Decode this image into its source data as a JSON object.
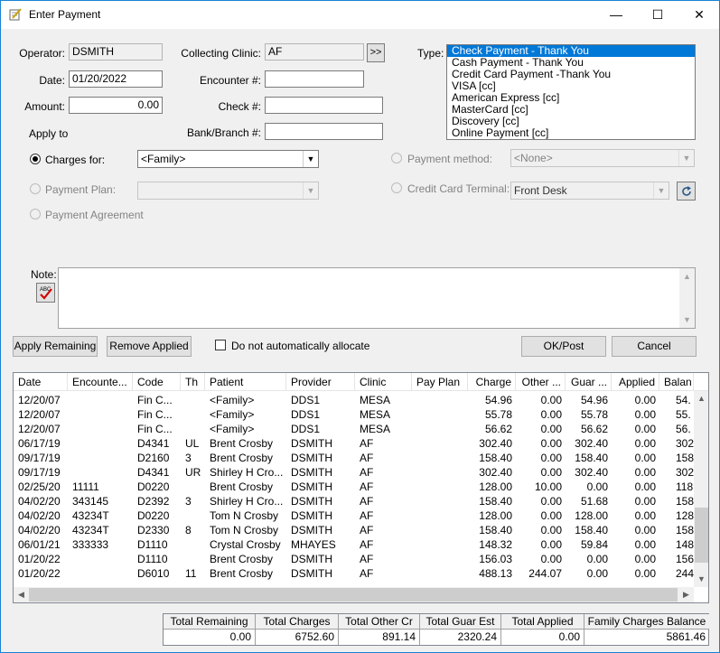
{
  "window": {
    "title": "Enter Payment",
    "minimize": "—",
    "maximize": "☐",
    "close": "✕"
  },
  "form": {
    "operator_label": "Operator:",
    "operator_value": "DSMITH",
    "date_label": "Date:",
    "date_value": "01/20/2022",
    "amount_label": "Amount:",
    "amount_value": "0.00",
    "apply_to_label": "Apply to",
    "collecting_clinic_label": "Collecting Clinic:",
    "collecting_clinic_value": "AF",
    "clinic_pick_button": ">>",
    "encounter_label": "Encounter #:",
    "encounter_value": "",
    "check_label": "Check #:",
    "check_value": "",
    "bank_label": "Bank/Branch #:",
    "bank_value": "",
    "type_label": "Type:",
    "type_options": [
      "Check Payment - Thank You",
      "Cash Payment - Thank You",
      "Credit Card Payment -Thank You",
      "VISA [cc]",
      "American Express [cc]",
      "MasterCard [cc]",
      "Discovery [cc]",
      "Online Payment [cc]"
    ],
    "charges_for_label": "Charges for:",
    "charges_for_value": "<Family>",
    "payment_plan_label": "Payment Plan:",
    "payment_plan_value": "",
    "payment_agreement_label": "Payment Agreement",
    "payment_method_label": "Payment method:",
    "payment_method_value": "<None>",
    "cc_terminal_label": "Credit Card Terminal:",
    "cc_terminal_value": "Front Desk",
    "note_label": "Note:",
    "spell_icon_text": "ABC"
  },
  "buttons": {
    "apply_remaining": "Apply Remaining",
    "remove_applied": "Remove Applied",
    "no_auto_allocate": "Do not automatically allocate",
    "ok_post": "OK/Post",
    "cancel": "Cancel"
  },
  "grid": {
    "headers": [
      "Date",
      "Encounte...",
      "Code",
      "Th",
      "Patient",
      "Provider",
      "Clinic",
      "Pay Plan",
      "Charge",
      "Other ...",
      "Guar ...",
      "Applied",
      "Balan"
    ],
    "rows": [
      [
        "12/20/07",
        "",
        "Fin C...",
        "",
        "<Family>",
        "DDS1",
        "MESA",
        "",
        "54.96",
        "0.00",
        "54.96",
        "0.00",
        "54."
      ],
      [
        "12/20/07",
        "",
        "Fin C...",
        "",
        "<Family>",
        "DDS1",
        "MESA",
        "",
        "55.78",
        "0.00",
        "55.78",
        "0.00",
        "55."
      ],
      [
        "12/20/07",
        "",
        "Fin C...",
        "",
        "<Family>",
        "DDS1",
        "MESA",
        "",
        "56.62",
        "0.00",
        "56.62",
        "0.00",
        "56."
      ],
      [
        "06/17/19",
        "",
        "D4341",
        "UL",
        "Brent Crosby",
        "DSMITH",
        "AF",
        "",
        "302.40",
        "0.00",
        "302.40",
        "0.00",
        "302."
      ],
      [
        "09/17/19",
        "",
        "D2160",
        "3",
        "Brent Crosby",
        "DSMITH",
        "AF",
        "",
        "158.40",
        "0.00",
        "158.40",
        "0.00",
        "158."
      ],
      [
        "09/17/19",
        "",
        "D4341",
        "UR",
        "Shirley H Cro...",
        "DSMITH",
        "AF",
        "",
        "302.40",
        "0.00",
        "302.40",
        "0.00",
        "302."
      ],
      [
        "02/25/20",
        "11111",
        "D0220",
        "",
        "Brent Crosby",
        "DSMITH",
        "AF",
        "",
        "128.00",
        "10.00",
        "0.00",
        "0.00",
        "118."
      ],
      [
        "04/02/20",
        "343145",
        "D2392",
        "3",
        "Shirley H Cro...",
        "DSMITH",
        "AF",
        "",
        "158.40",
        "0.00",
        "51.68",
        "0.00",
        "158."
      ],
      [
        "04/02/20",
        "43234T",
        "D0220",
        "",
        "Tom N Crosby",
        "DSMITH",
        "AF",
        "",
        "128.00",
        "0.00",
        "128.00",
        "0.00",
        "128."
      ],
      [
        "04/02/20",
        "43234T",
        "D2330",
        "8",
        "Tom N Crosby",
        "DSMITH",
        "AF",
        "",
        "158.40",
        "0.00",
        "158.40",
        "0.00",
        "158."
      ],
      [
        "06/01/21",
        "333333",
        "D1110",
        "",
        "Crystal Crosby",
        "MHAYES",
        "AF",
        "",
        "148.32",
        "0.00",
        "59.84",
        "0.00",
        "148."
      ],
      [
        "01/20/22",
        "",
        "D1110",
        "",
        "Brent Crosby",
        "DSMITH",
        "AF",
        "",
        "156.03",
        "0.00",
        "0.00",
        "0.00",
        "156."
      ],
      [
        "01/20/22",
        "",
        "D6010",
        "11",
        "Brent Crosby",
        "DSMITH",
        "AF",
        "",
        "488.13",
        "244.07",
        "0.00",
        "0.00",
        "244."
      ]
    ]
  },
  "totals": {
    "headers": [
      "Total Remaining",
      "Total Charges",
      "Total Other Cr",
      "Total Guar Est",
      "Total Applied",
      "Family Charges Balance"
    ],
    "values": [
      "0.00",
      "6752.60",
      "891.14",
      "2320.24",
      "0.00",
      "5861.46"
    ]
  }
}
